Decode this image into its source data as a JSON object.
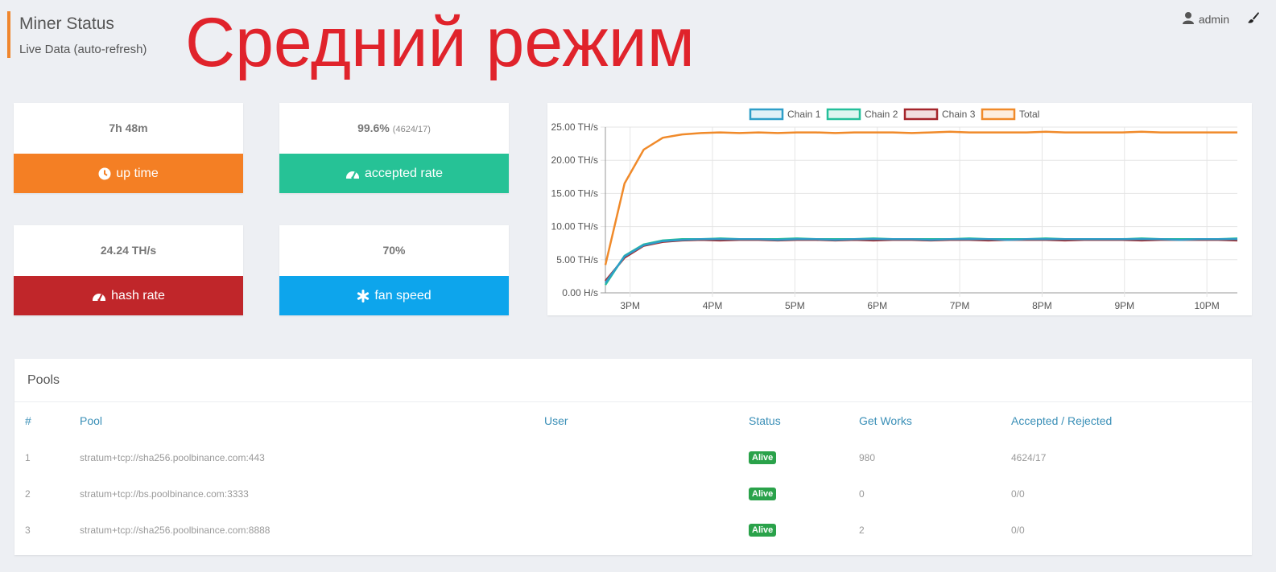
{
  "header": {
    "title": "Miner Status",
    "subtitle": "Live Data (auto-refresh)"
  },
  "overlay_text": "Средний режим",
  "user": {
    "name": "admin"
  },
  "cards": {
    "uptime": {
      "value": "7h 48m",
      "label": "up time",
      "color": "#f47f24"
    },
    "accepted": {
      "value": "99.6%",
      "detail": "(4624/17)",
      "label": "accepted rate",
      "color": "#26c296"
    },
    "hashrate": {
      "value": "24.24 TH/s",
      "label": "hash rate",
      "color": "#c0262a"
    },
    "fan": {
      "value": "70%",
      "label": "fan speed",
      "color": "#0da5ec"
    }
  },
  "chart_data": {
    "type": "line",
    "legend": [
      "Chain 1",
      "Chain 2",
      "Chain 3",
      "Total"
    ],
    "colors": {
      "Chain 1": "#2e9ec8",
      "Chain 2": "#24bf9a",
      "Chain 3": "#a5252b",
      "Total": "#f08a2a"
    },
    "y_ticks": [
      "0.00 H/s",
      "5.00 TH/s",
      "10.00 TH/s",
      "15.00 TH/s",
      "20.00 TH/s",
      "25.00 TH/s"
    ],
    "x_ticks": [
      "3PM",
      "4PM",
      "5PM",
      "6PM",
      "7PM",
      "8PM",
      "9PM",
      "10PM"
    ],
    "ylim": [
      0,
      25
    ],
    "x_start_hour": 14.7,
    "x_end_hour": 22.37,
    "series": [
      {
        "name": "Chain 1",
        "values": [
          1.5,
          5.5,
          7.2,
          7.8,
          8.0,
          8.1,
          8.1,
          8.1,
          8.1,
          8.0,
          8.1,
          8.1,
          8.0,
          8.1,
          8.1,
          8.1,
          8.1,
          8.0,
          8.1,
          8.1,
          8.1,
          8.0,
          8.1,
          8.1,
          8.1,
          8.1,
          8.1,
          8.1,
          8.1,
          8.1,
          8.0,
          8.1,
          8.1,
          8.1
        ]
      },
      {
        "name": "Chain 2",
        "values": [
          1.2,
          5.6,
          7.3,
          7.9,
          8.1,
          8.1,
          8.2,
          8.1,
          8.1,
          8.1,
          8.2,
          8.1,
          8.1,
          8.1,
          8.2,
          8.1,
          8.1,
          8.1,
          8.1,
          8.2,
          8.1,
          8.1,
          8.1,
          8.2,
          8.1,
          8.1,
          8.1,
          8.1,
          8.2,
          8.1,
          8.1,
          8.1,
          8.1,
          8.2
        ]
      },
      {
        "name": "Chain 3",
        "values": [
          1.8,
          5.3,
          7.1,
          7.7,
          7.9,
          8.0,
          7.9,
          8.0,
          8.0,
          7.9,
          8.0,
          8.0,
          7.9,
          8.0,
          7.9,
          8.0,
          8.0,
          7.9,
          8.0,
          8.0,
          7.9,
          8.0,
          8.0,
          8.0,
          7.9,
          8.0,
          8.0,
          8.0,
          7.9,
          8.0,
          8.0,
          8.0,
          8.0,
          7.9
        ]
      },
      {
        "name": "Total",
        "values": [
          4.2,
          16.5,
          21.6,
          23.4,
          23.9,
          24.1,
          24.2,
          24.1,
          24.2,
          24.1,
          24.2,
          24.2,
          24.1,
          24.2,
          24.2,
          24.2,
          24.1,
          24.2,
          24.3,
          24.2,
          24.2,
          24.2,
          24.2,
          24.3,
          24.2,
          24.2,
          24.2,
          24.2,
          24.3,
          24.2,
          24.2,
          24.2,
          24.2,
          24.2
        ]
      }
    ]
  },
  "pools": {
    "title": "Pools",
    "columns": [
      "#",
      "Pool",
      "User",
      "Status",
      "Get Works",
      "Accepted / Rejected"
    ],
    "rows": [
      {
        "num": "1",
        "pool": "stratum+tcp://sha256.poolbinance.com:443",
        "user": "",
        "status": "Alive",
        "works": "980",
        "ar": "4624/17"
      },
      {
        "num": "2",
        "pool": "stratum+tcp://bs.poolbinance.com:3333",
        "user": "",
        "status": "Alive",
        "works": "0",
        "ar": "0/0"
      },
      {
        "num": "3",
        "pool": "stratum+tcp://sha256.poolbinance.com:8888",
        "user": "",
        "status": "Alive",
        "works": "2",
        "ar": "0/0"
      }
    ]
  },
  "icons": [
    "clock-icon",
    "gauge-icon",
    "asterisk-icon",
    "user-icon",
    "brush-icon"
  ]
}
